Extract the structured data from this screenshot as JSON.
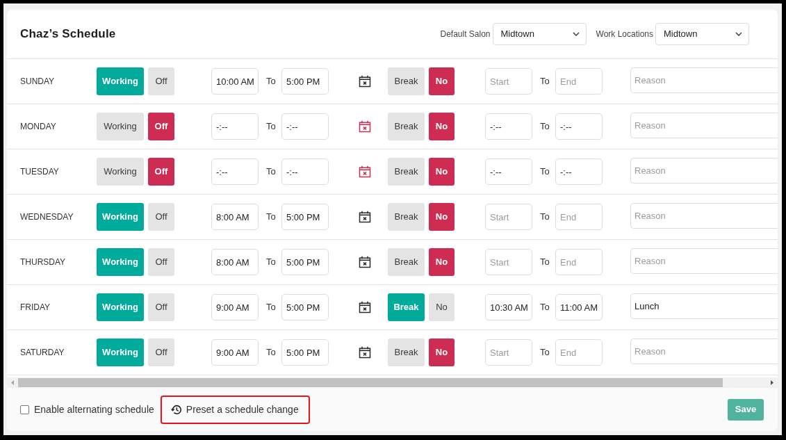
{
  "title": "Chaz’s Schedule",
  "filters": [
    {
      "label": "Default Salon",
      "value": "Midtown"
    },
    {
      "label": "Work Locations",
      "value": "Midtown"
    }
  ],
  "days": [
    {
      "day": "SUNDAY",
      "status": [
        {
          "label": "Working",
          "selected": true
        },
        {
          "label": "Off",
          "selected": false
        }
      ],
      "hours": {
        "start": {
          "value": "10:00 AM"
        },
        "to": "To",
        "end": {
          "value": "5:00 PM"
        }
      },
      "break": [
        {
          "label": "Break",
          "selected": false
        },
        {
          "label": "No",
          "selected": true
        }
      ],
      "break_hours": {
        "start": {
          "placeholder": "Start"
        },
        "to": "To",
        "end": {
          "placeholder": "End"
        }
      },
      "reason": {
        "placeholder": "Reason"
      }
    },
    {
      "day": "MONDAY",
      "status": [
        {
          "label": "Working",
          "selected": false
        },
        {
          "label": "Off",
          "selected": true
        }
      ],
      "hours": {
        "start": {
          "value": "-:--"
        },
        "to": "To",
        "end": {
          "value": "-:--"
        }
      },
      "break": [
        {
          "label": "Break",
          "selected": false
        },
        {
          "label": "No",
          "selected": true
        }
      ],
      "break_hours": {
        "start": {
          "value": "-:--"
        },
        "to": "To",
        "end": {
          "value": "-:--"
        }
      },
      "reason": {
        "placeholder": "Reason"
      }
    },
    {
      "day": "TUESDAY",
      "status": [
        {
          "label": "Working",
          "selected": false
        },
        {
          "label": "Off",
          "selected": true
        }
      ],
      "hours": {
        "start": {
          "value": "-:--"
        },
        "to": "To",
        "end": {
          "value": "-:--"
        }
      },
      "break": [
        {
          "label": "Break",
          "selected": false
        },
        {
          "label": "No",
          "selected": true
        }
      ],
      "break_hours": {
        "start": {
          "value": "-:--"
        },
        "to": "To",
        "end": {
          "value": "-:--"
        }
      },
      "reason": {
        "placeholder": "Reason"
      }
    },
    {
      "day": "WEDNESDAY",
      "status": [
        {
          "label": "Working",
          "selected": true
        },
        {
          "label": "Off",
          "selected": false
        }
      ],
      "hours": {
        "start": {
          "value": "8:00 AM"
        },
        "to": "To",
        "end": {
          "value": "5:00 PM"
        }
      },
      "break": [
        {
          "label": "Break",
          "selected": false
        },
        {
          "label": "No",
          "selected": true
        }
      ],
      "break_hours": {
        "start": {
          "placeholder": "Start"
        },
        "to": "To",
        "end": {
          "placeholder": "End"
        }
      },
      "reason": {
        "placeholder": "Reason"
      }
    },
    {
      "day": "THURSDAY",
      "status": [
        {
          "label": "Working",
          "selected": true
        },
        {
          "label": "Off",
          "selected": false
        }
      ],
      "hours": {
        "start": {
          "value": "8:00 AM"
        },
        "to": "To",
        "end": {
          "value": "5:00 PM"
        }
      },
      "break": [
        {
          "label": "Break",
          "selected": false
        },
        {
          "label": "No",
          "selected": true
        }
      ],
      "break_hours": {
        "start": {
          "placeholder": "Start"
        },
        "to": "To",
        "end": {
          "placeholder": "End"
        }
      },
      "reason": {
        "placeholder": "Reason"
      }
    },
    {
      "day": "FRIDAY",
      "status": [
        {
          "label": "Working",
          "selected": true
        },
        {
          "label": "Off",
          "selected": false
        }
      ],
      "hours": {
        "start": {
          "value": "9:00 AM"
        },
        "to": "To",
        "end": {
          "value": "5:00 PM"
        }
      },
      "break": [
        {
          "label": "Break",
          "selected": true
        },
        {
          "label": "No",
          "selected": false
        }
      ],
      "break_hours": {
        "start": {
          "value": "10:30 AM"
        },
        "to": "To",
        "end": {
          "value": "11:00 AM"
        }
      },
      "reason": {
        "value": "Lunch"
      }
    },
    {
      "day": "SATURDAY",
      "status": [
        {
          "label": "Working",
          "selected": true
        },
        {
          "label": "Off",
          "selected": false
        }
      ],
      "hours": {
        "start": {
          "value": "9:00 AM"
        },
        "to": "To",
        "end": {
          "value": "5:00 PM"
        }
      },
      "break": [
        {
          "label": "Break",
          "selected": false
        },
        {
          "label": "No",
          "selected": true
        }
      ],
      "break_hours": {
        "start": {
          "placeholder": "Start"
        },
        "to": "To",
        "end": {
          "placeholder": "End"
        }
      },
      "reason": {
        "placeholder": "Reason"
      }
    }
  ],
  "footer": {
    "alternating": {
      "label": "Enable alternating schedule",
      "checked": false
    },
    "preset_button": "Preset a schedule change",
    "save_button": "Save"
  }
}
